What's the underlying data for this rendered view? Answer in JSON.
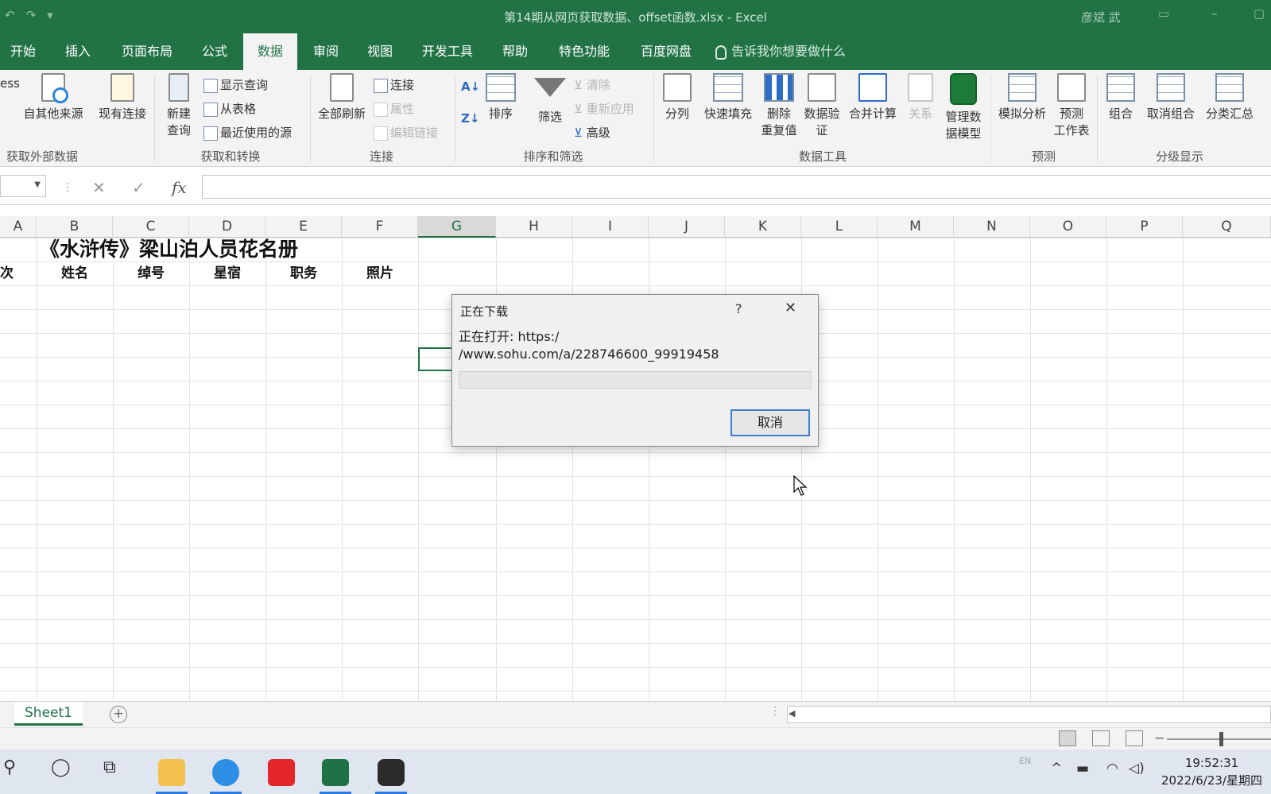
{
  "app": {
    "window_title": "第14期从网页获取数据、offset函数.xlsx  -  Excel",
    "user_name": "彦斌 武"
  },
  "ribbon_tabs": [
    {
      "label": "开始"
    },
    {
      "label": "插入"
    },
    {
      "label": "页面布局"
    },
    {
      "label": "公式"
    },
    {
      "label": "数据",
      "active": true
    },
    {
      "label": "审阅"
    },
    {
      "label": "视图"
    },
    {
      "label": "开发工具"
    },
    {
      "label": "帮助"
    },
    {
      "label": "特色功能"
    },
    {
      "label": "百度网盘"
    }
  ],
  "tell_me": "告诉我你想要做什么",
  "ribbon": {
    "get_external": {
      "cut_label": "ess",
      "from_other": "自其他来源",
      "existing": "现有连接",
      "group": "获取外部数据"
    },
    "get_transform": {
      "new_query_1": "新建",
      "new_query_2": "查询",
      "show_queries": "显示查询",
      "from_table": "从表格",
      "recent_sources": "最近使用的源",
      "group": "获取和转换"
    },
    "connections": {
      "refresh_all": "全部刷新",
      "connections": "连接",
      "properties": "属性",
      "edit_links": "编辑链接",
      "group": "连接"
    },
    "sort_filter": {
      "sort": "排序",
      "filter": "筛选",
      "clear": "清除",
      "reapply": "重新应用",
      "advanced": "高级",
      "group": "排序和筛选"
    },
    "data_tools": {
      "split": "分列",
      "flash_fill": "快速填充",
      "remove_dup_1": "删除",
      "remove_dup_2": "重复值",
      "validation_1": "数据验",
      "validation_2": "证",
      "consolidate": "合并计算",
      "relationships": "关系",
      "manage_model_1": "管理数",
      "manage_model_2": "据模型",
      "group": "数据工具"
    },
    "forecast": {
      "whatif": "模拟分析",
      "forecast_1": "预测",
      "forecast_2": "工作表",
      "group": "预测"
    },
    "outline": {
      "group_btn": "组合",
      "ungroup": "取消组合",
      "subtotal": "分类汇总",
      "group": "分级显示"
    }
  },
  "formula_bar": {
    "name_box": "",
    "fx": "fx",
    "value": ""
  },
  "columns": [
    "A",
    "B",
    "C",
    "D",
    "E",
    "F",
    "G",
    "H",
    "I",
    "J",
    "K",
    "L",
    "M",
    "N",
    "O",
    "P",
    "Q"
  ],
  "selected_column": "G",
  "sheet_content": {
    "title": "《水浒传》梁山泊人员花名册",
    "headers": [
      "次",
      "姓名",
      "绰号",
      "星宿",
      "职务",
      "照片"
    ]
  },
  "sheet_tabs": [
    {
      "label": "Sheet1",
      "active": true
    }
  ],
  "dialog": {
    "title": "正在下载",
    "help": "?",
    "close": "✕",
    "line1": "正在打开: https:/",
    "line2": "/www.sohu.com/a/228746600_99919458",
    "progress": 0,
    "cancel": "取消"
  },
  "taskbar": {
    "ime": "EN",
    "time": "19:52:31",
    "date": "2022/6/23/星期四"
  }
}
